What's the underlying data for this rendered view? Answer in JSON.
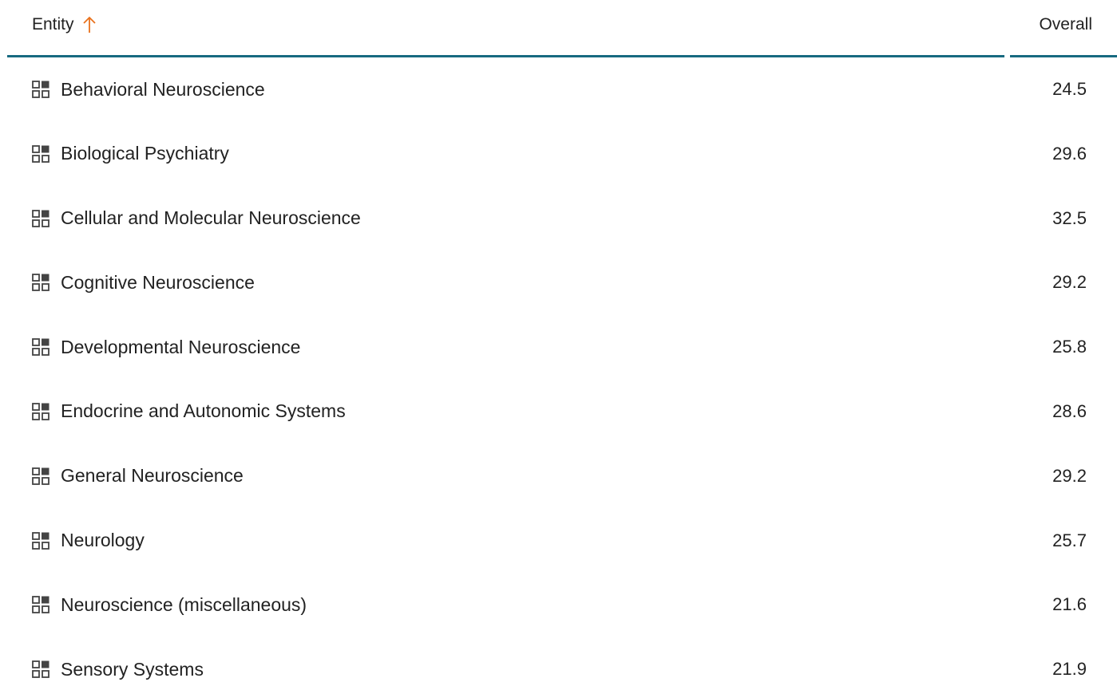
{
  "header": {
    "entity_label": "Entity",
    "overall_label": "Overall",
    "sort_icon": "arrow-up-icon",
    "accent_color": "#e9711c",
    "rule_color": "#176a80"
  },
  "rows": [
    {
      "entity": "Behavioral Neuroscience",
      "overall": "24.5",
      "icon": "grid-icon"
    },
    {
      "entity": "Biological Psychiatry",
      "overall": "29.6",
      "icon": "grid-icon"
    },
    {
      "entity": "Cellular and Molecular Neuroscience",
      "overall": "32.5",
      "icon": "grid-icon"
    },
    {
      "entity": "Cognitive Neuroscience",
      "overall": "29.2",
      "icon": "grid-icon"
    },
    {
      "entity": "Developmental Neuroscience",
      "overall": "25.8",
      "icon": "grid-icon"
    },
    {
      "entity": "Endocrine and Autonomic Systems",
      "overall": "28.6",
      "icon": "grid-icon"
    },
    {
      "entity": "General Neuroscience",
      "overall": "29.2",
      "icon": "grid-icon"
    },
    {
      "entity": "Neurology",
      "overall": "25.7",
      "icon": "grid-icon"
    },
    {
      "entity": "Neuroscience (miscellaneous)",
      "overall": "21.6",
      "icon": "grid-icon"
    },
    {
      "entity": "Sensory Systems",
      "overall": "21.9",
      "icon": "grid-icon"
    }
  ]
}
